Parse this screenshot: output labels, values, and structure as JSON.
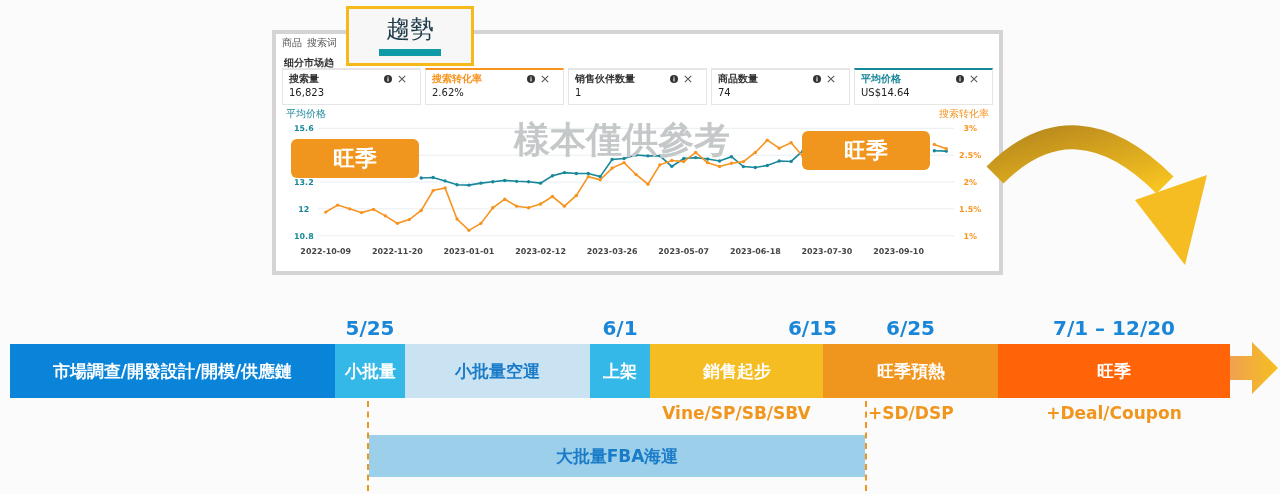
{
  "screenshot": {
    "tabs": [
      {
        "label": "商品",
        "selected": false
      },
      {
        "label": "搜索词",
        "selected": false
      }
    ],
    "section_title": "细分市场趋",
    "cards": [
      {
        "label": "搜索量",
        "value": "16,823"
      },
      {
        "label": "搜索转化率",
        "value": "2.62%",
        "color": "#f7931e"
      },
      {
        "label": "销售伙伴数量",
        "value": "1"
      },
      {
        "label": "商品数量",
        "value": "74"
      },
      {
        "label": "平均价格",
        "value": "US$14.64",
        "color": "#17879a"
      }
    ],
    "chart_data": {
      "type": "line",
      "grid": true,
      "categories": [
        "2022-10-09",
        null,
        null,
        null,
        null,
        null,
        "2022-11-20",
        null,
        null,
        null,
        null,
        null,
        "2023-01-01",
        null,
        null,
        null,
        null,
        null,
        "2023-02-12",
        null,
        null,
        null,
        null,
        null,
        "2023-03-26",
        null,
        null,
        null,
        null,
        null,
        "2023-05-07",
        null,
        null,
        null,
        null,
        null,
        "2023-06-18",
        null,
        null,
        null,
        null,
        null,
        "2023-07-30",
        null,
        null,
        null,
        null,
        null,
        "2023-09-10",
        null,
        null,
        null,
        null
      ],
      "ylim": [
        10.8,
        15.6
      ],
      "yticks": [
        10.8,
        12,
        13.2,
        15.6
      ],
      "y2lim": [
        1,
        3
      ],
      "y2ticks": [
        {
          "value": 1,
          "label": "1%"
        },
        {
          "value": 1.5,
          "label": "1.5%"
        },
        {
          "value": 2,
          "label": "2%"
        },
        {
          "value": 2.5,
          "label": "2.5%"
        },
        {
          "value": 3,
          "label": "3%"
        }
      ],
      "series": [
        {
          "name": "平均价格",
          "color": "#17879a",
          "values": [
            null,
            null,
            null,
            null,
            null,
            null,
            null,
            null,
            13.38,
            13.4,
            13.25,
            13.08,
            13.06,
            13.15,
            13.21,
            13.27,
            13.23,
            13.21,
            13.15,
            13.48,
            13.62,
            13.58,
            13.58,
            13.44,
            14.21,
            14.25,
            14.41,
            14.37,
            14.37,
            13.9,
            14.25,
            14.29,
            14.23,
            14.14,
            14.33,
            13.89,
            13.85,
            13.94,
            14.14,
            14.12,
            14.6,
            null,
            null,
            null,
            null,
            null,
            null,
            null,
            null,
            null,
            null,
            14.6,
            14.58
          ]
        },
        {
          "name": "搜索转化率",
          "axis": "y2",
          "color": "#f7931e",
          "values": [
            1.44,
            1.57,
            1.5,
            1.43,
            1.49,
            1.37,
            1.23,
            1.3,
            1.47,
            1.84,
            1.89,
            1.31,
            1.1,
            1.23,
            1.52,
            1.68,
            1.55,
            1.52,
            1.59,
            1.73,
            1.55,
            1.75,
            2.1,
            2.04,
            2.26,
            2.36,
            2.14,
            1.96,
            2.32,
            2.4,
            2.38,
            2.55,
            2.36,
            2.29,
            2.35,
            2.38,
            2.55,
            2.78,
            2.63,
            2.73,
            2.47,
            null,
            null,
            null,
            null,
            null,
            null,
            null,
            null,
            null,
            null,
            2.7,
            2.62
          ]
        }
      ]
    },
    "watermark_text": "樣本僅供參考",
    "season_labels": [
      "旺季",
      "旺季"
    ]
  },
  "trend_callout": {
    "title": "趨勢"
  },
  "timeline": {
    "dates": [
      "5/25",
      "6/1",
      "6/15",
      "6/25",
      "7/1 – 12/20"
    ],
    "segments": [
      {
        "label": "市場調查/開發設計/開模/供應鏈",
        "color": "#0a84d8"
      },
      {
        "label": "小批量",
        "color": "#33b8e8"
      },
      {
        "label": "小批量空運",
        "color": "#c9e3f3"
      },
      {
        "label": "上架",
        "color": "#33b8e8"
      },
      {
        "label": "銷售起步",
        "color": "#f5bd22"
      },
      {
        "label": "旺季預熱",
        "color": "#f0961e"
      },
      {
        "label": "旺季",
        "color": "#ff6408"
      }
    ],
    "ad_notes": [
      "Vine/SP/SB/SBV",
      "+SD/DSP",
      "+Deal/Coupon"
    ],
    "shipping_bar": "大批量FBA海運"
  }
}
